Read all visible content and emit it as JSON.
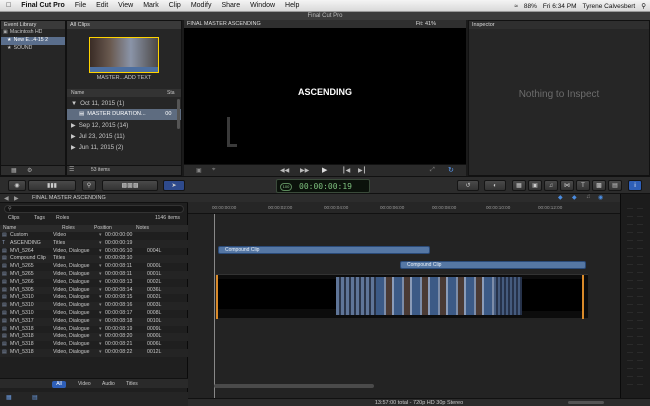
{
  "menubar": {
    "items": [
      "Final Cut Pro",
      "File",
      "Edit",
      "View",
      "Mark",
      "Clip",
      "Modify",
      "Share",
      "Window",
      "Help"
    ],
    "status": "88%",
    "clock": "Fri 6:34 PM",
    "user": "Tyrene Calvesbert"
  },
  "window_title": "Final Cut Pro",
  "library": {
    "title": "Event Library",
    "items": [
      "Macintosh HD",
      "New E...4-15 2",
      "SOUND"
    ]
  },
  "browser": {
    "filter": "All Clips",
    "thumb_label": "MASTER...ADD TEXT",
    "col_name": "Name",
    "col_start": "Sta",
    "groups": [
      {
        "label": "Oct 11, 2015  (1)",
        "expanded": true
      },
      {
        "label": "MASTER DURATION...",
        "clip": true,
        "value": "00"
      },
      {
        "label": "Sep 12, 2015  (14)"
      },
      {
        "label": "Jul 23, 2015  (11)"
      },
      {
        "label": "Jun 11, 2015  (2)"
      }
    ],
    "count": "53 items"
  },
  "viewer": {
    "title": "FINAL MASTER ASCENDING",
    "fit": "Fit:  41%",
    "overlay": "ASCENDING"
  },
  "inspector": {
    "title": "Inspector",
    "empty": "Nothing to Inspect"
  },
  "toolbar": {
    "timecode": "00:00:00:19",
    "timecode_label": "100"
  },
  "index": {
    "project": "FINAL MASTER ASCENDING",
    "tabs": [
      "Clips",
      "Tags",
      "Roles"
    ],
    "count": "1146 items",
    "search_placeholder": "",
    "cols": [
      "Name",
      "Roles",
      "Position",
      "Notes"
    ],
    "rows": [
      [
        "Custom",
        "Video",
        "00:00:00:00",
        ""
      ],
      [
        "ASCENDING",
        "Titles",
        "00:00:00:19",
        ""
      ],
      [
        "MVI_5264",
        "Video, Dialogue",
        "00:00:06:10",
        "0004L"
      ],
      [
        "Compound Clip",
        "Titles",
        "00:00:08:10",
        ""
      ],
      [
        "MVI_5265",
        "Video, Dialogue",
        "00:00:08:11",
        "0000L"
      ],
      [
        "MVI_5265",
        "Video, Dialogue",
        "00:00:08:11",
        "0001L"
      ],
      [
        "MVI_5266",
        "Video, Dialogue",
        "00:00:08:13",
        "0002L"
      ],
      [
        "MVI_5305",
        "Video, Dialogue",
        "00:00:08:14",
        "0036L"
      ],
      [
        "MVI_5310",
        "Video, Dialogue",
        "00:00:08:15",
        "0002L"
      ],
      [
        "MVI_5310",
        "Video, Dialogue",
        "00:00:08:16",
        "0003L"
      ],
      [
        "MVI_5310",
        "Video, Dialogue",
        "00:00:08:17",
        "0008L"
      ],
      [
        "MVI_5317",
        "Video, Dialogue",
        "00:00:08:18",
        "0010L"
      ],
      [
        "MVI_5318",
        "Video, Dialogue",
        "00:00:08:19",
        "0009L"
      ],
      [
        "MVI_5318",
        "Video, Dialogue",
        "00:00:08:20",
        "0000L"
      ],
      [
        "MVI_5318",
        "Video, Dialogue",
        "00:00:08:21",
        "0006L"
      ],
      [
        "MVI_5318",
        "Video, Dialogue",
        "00:00:08:22",
        "0012L"
      ]
    ],
    "filters": [
      "All",
      "Video",
      "Audio",
      "Titles"
    ]
  },
  "timeline": {
    "ruler": [
      "00:00:00:00",
      "00:00:02:00",
      "00:00:04:00",
      "00:00:06:00",
      "00:00:08:00",
      "00:00:10:00",
      "00:00:12:00"
    ],
    "clip1": "Compound Clip",
    "clip2": "Compound Clip"
  },
  "status": "13:57:00 total - 720p HD 30p Stereo"
}
